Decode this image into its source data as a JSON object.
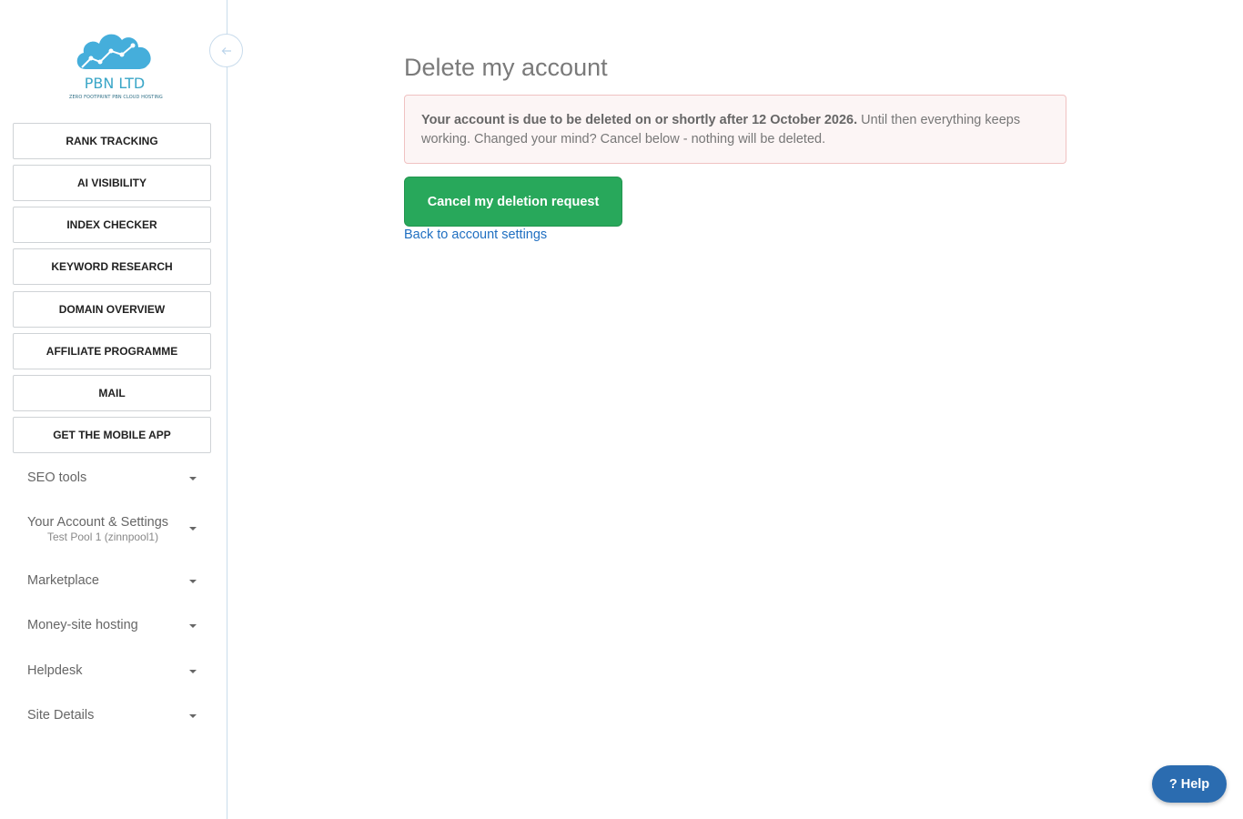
{
  "brand": {
    "name": "PBN LTD",
    "tagline": "ZERO FOOTPRINT PBN CLOUD HOSTING"
  },
  "sidebar": {
    "buttons": [
      {
        "label": "RANK TRACKING"
      },
      {
        "label": "AI VISIBILITY"
      },
      {
        "label": "INDEX CHECKER"
      },
      {
        "label": "KEYWORD RESEARCH"
      },
      {
        "label": "DOMAIN OVERVIEW"
      },
      {
        "label": "AFFILIATE PROGRAMME"
      },
      {
        "label": "MAIL"
      },
      {
        "label": "GET THE MOBILE APP"
      }
    ],
    "menus": [
      {
        "label": "SEO tools"
      },
      {
        "label": "Your Account & Settings",
        "sub": "Test Pool 1 (zinnpool1)"
      },
      {
        "label": "Marketplace"
      },
      {
        "label": "Money-site hosting"
      },
      {
        "label": "Helpdesk"
      },
      {
        "label": "Site Details"
      }
    ]
  },
  "main": {
    "title": "Delete my account",
    "alert_bold": "Your account is due to be deleted on or shortly after 12 October 2026.",
    "alert_text": " Until then everything keeps working. Changed your mind? Cancel below - nothing will be deleted.",
    "cancel_label": "Cancel my deletion request",
    "back_link": "Back to account settings"
  },
  "help": {
    "label": "? Help"
  },
  "colors": {
    "accent_green": "#28a85b",
    "link_blue": "#1f6fc1",
    "help_blue": "#2b6cb0",
    "logo_cloud": "#45aedb"
  },
  "icons": {
    "logo": "cloud-chart-icon",
    "collapse": "arrow-left-icon",
    "caret": "caret-down-icon"
  }
}
